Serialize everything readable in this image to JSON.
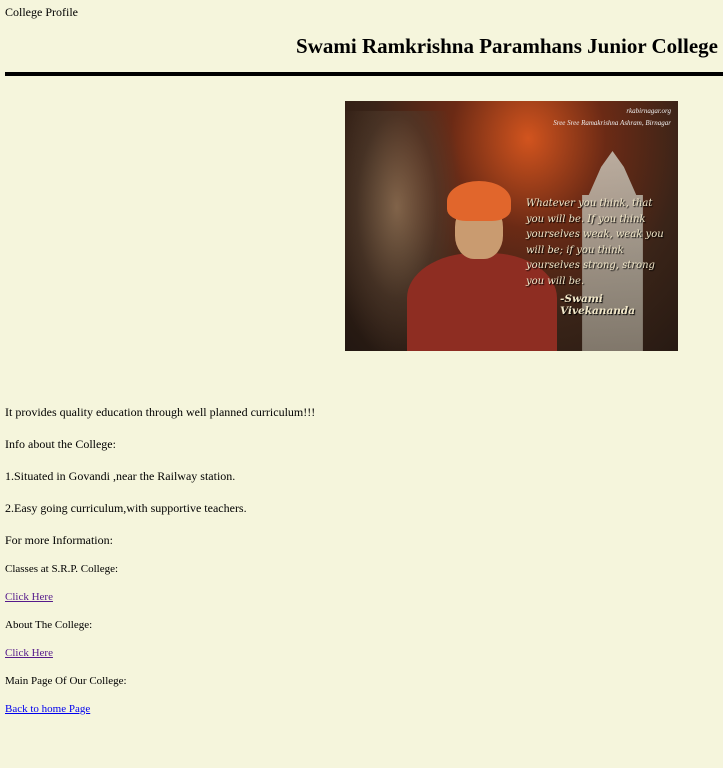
{
  "header": {
    "top_label": "College Profile",
    "title": "Swami Ramkrishna Paramhans Junior College"
  },
  "hero": {
    "watermark_site": "rkabirnagar.org",
    "watermark_org": "Sree Sree Ramakrishna Ashram, Birnagar",
    "quote": "Whatever you think, that you will be. If you think yourselves weak, weak you will be; if you think yourselves strong, strong you will be.",
    "author": "-Swami Vivekananda"
  },
  "content": {
    "intro": "It provides quality education through well planned curriculum!!!",
    "info_heading": "Info about the College:",
    "point1": "1.Situated in Govandi ,near the Railway station.",
    "point2": "2.Easy going curriculum,with supportive teachers.",
    "more_info": "For more Information:",
    "classes_label": "Classes at S.R.P. College:",
    "classes_link": "Click Here",
    "about_label": "About The College:",
    "about_link": "Click Here",
    "main_label": "Main Page Of Our College:",
    "home_link": "Back to home Page"
  }
}
